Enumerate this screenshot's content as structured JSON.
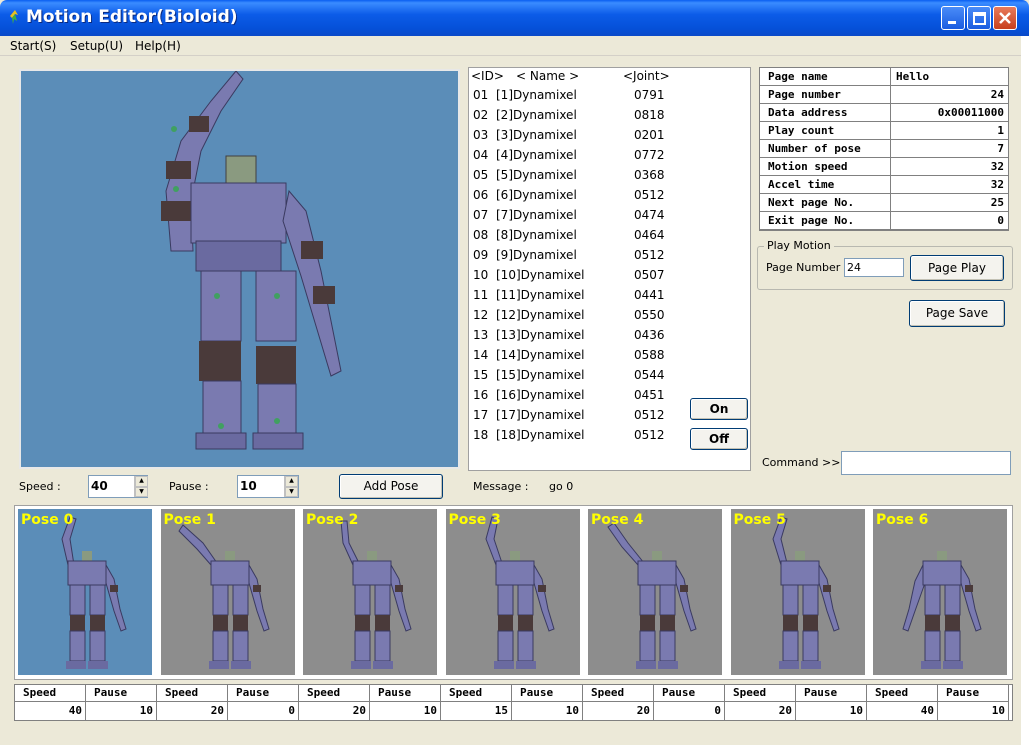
{
  "window": {
    "title": "Motion Editor(Bioloid)"
  },
  "menu": [
    "Start(S)",
    "Setup(U)",
    "Help(H)"
  ],
  "joint_list": {
    "headers": {
      "id": "<ID>",
      "name": "< Name >",
      "joint": "<Joint>"
    },
    "rows": [
      {
        "id": "01",
        "name": "[1]Dynamixel",
        "value": "0791"
      },
      {
        "id": "02",
        "name": "[2]Dynamixel",
        "value": "0818"
      },
      {
        "id": "03",
        "name": "[3]Dynamixel",
        "value": "0201"
      },
      {
        "id": "04",
        "name": "[4]Dynamixel",
        "value": "0772"
      },
      {
        "id": "05",
        "name": "[5]Dynamixel",
        "value": "0368"
      },
      {
        "id": "06",
        "name": "[6]Dynamixel",
        "value": "0512"
      },
      {
        "id": "07",
        "name": "[7]Dynamixel",
        "value": "0474"
      },
      {
        "id": "08",
        "name": "[8]Dynamixel",
        "value": "0464"
      },
      {
        "id": "09",
        "name": "[9]Dynamixel",
        "value": "0512"
      },
      {
        "id": "10",
        "name": "[10]Dynamixel",
        "value": "0507"
      },
      {
        "id": "11",
        "name": "[11]Dynamixel",
        "value": "0441"
      },
      {
        "id": "12",
        "name": "[12]Dynamixel",
        "value": "0550"
      },
      {
        "id": "13",
        "name": "[13]Dynamixel",
        "value": "0436"
      },
      {
        "id": "14",
        "name": "[14]Dynamixel",
        "value": "0588"
      },
      {
        "id": "15",
        "name": "[15]Dynamixel",
        "value": "0544"
      },
      {
        "id": "16",
        "name": "[16]Dynamixel",
        "value": "0451"
      },
      {
        "id": "17",
        "name": "[17]Dynamixel",
        "value": "0512"
      },
      {
        "id": "18",
        "name": "[18]Dynamixel",
        "value": "0512"
      }
    ],
    "on_label": "On",
    "off_label": "Off"
  },
  "properties": [
    {
      "label": "Page name",
      "value": "Hello"
    },
    {
      "label": "Page number",
      "value": "24"
    },
    {
      "label": "Data address",
      "value": "0x00011000"
    },
    {
      "label": "Play count",
      "value": "1"
    },
    {
      "label": "Number of pose",
      "value": "7"
    },
    {
      "label": "Motion speed",
      "value": "32"
    },
    {
      "label": "Accel time",
      "value": "32"
    },
    {
      "label": "Next page No.",
      "value": "25"
    },
    {
      "label": "Exit page No.",
      "value": "0"
    }
  ],
  "play_motion": {
    "legend": "Play Motion",
    "page_number_label": "Page Number :",
    "page_number_value": "24",
    "page_play_label": "Page Play",
    "page_save_label": "Page Save"
  },
  "command": {
    "label": "Command >>",
    "value": ""
  },
  "controls": {
    "speed_label": "Speed :",
    "speed_value": "40",
    "pause_label": "Pause :",
    "pause_value": "10",
    "add_pose_label": "Add Pose",
    "message_label": "Message :",
    "message_value": "go 0"
  },
  "poses": [
    {
      "label": "Pose 0",
      "speed": "40",
      "pause": "10",
      "active": true
    },
    {
      "label": "Pose 1",
      "speed": "20",
      "pause": "0",
      "active": false
    },
    {
      "label": "Pose 2",
      "speed": "20",
      "pause": "10",
      "active": false
    },
    {
      "label": "Pose 3",
      "speed": "15",
      "pause": "10",
      "active": false
    },
    {
      "label": "Pose 4",
      "speed": "20",
      "pause": "0",
      "active": false
    },
    {
      "label": "Pose 5",
      "speed": "20",
      "pause": "10",
      "active": false
    },
    {
      "label": "Pose 6",
      "speed": "40",
      "pause": "10",
      "active": false
    }
  ],
  "pose_table_headers": {
    "speed": "Speed",
    "pause": "Pause"
  },
  "colors": {
    "viewport_bg": "#5b8db8",
    "pose_bg": "#8d8d8d",
    "pose_label": "#ffff00",
    "robot_body": "#7a7ab0",
    "robot_joint": "#4a3a3a"
  }
}
